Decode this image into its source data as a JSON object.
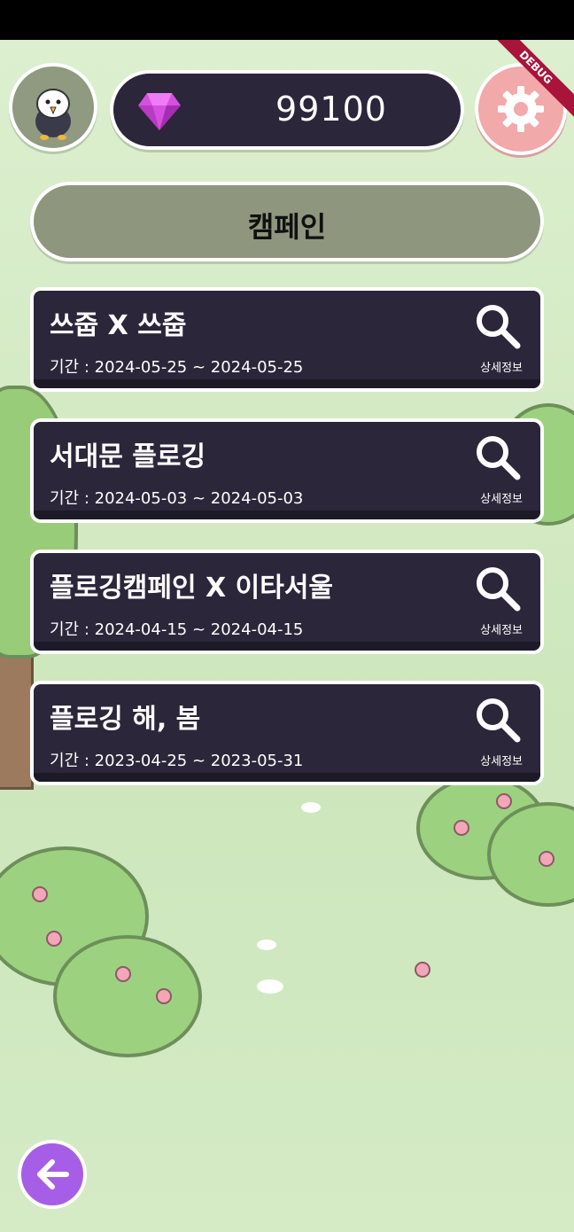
{
  "header": {
    "gem_count": "99100",
    "debug_label": "DEBUG",
    "colors": {
      "gem_bar": "#2b2639",
      "settings": "#f2a9a9",
      "accent": "#a65ee6"
    }
  },
  "campaign": {
    "title": "캠페인",
    "items": [
      {
        "name": "쓰줍 X 쓰줍",
        "period": "기간 : 2024-05-25 ~ 2024-05-25",
        "detail_label": "상세정보"
      },
      {
        "name": "서대문 플로깅",
        "period": "기간 : 2024-05-03 ~ 2024-05-03",
        "detail_label": "상세정보"
      },
      {
        "name": "플로깅캠페인 X 이타서울",
        "period": "기간 : 2024-04-15 ~ 2024-04-15",
        "detail_label": "상세정보"
      },
      {
        "name": "플로깅 해, 봄",
        "period": "기간 : 2023-04-25 ~ 2023-05-31",
        "detail_label": "상세정보"
      }
    ]
  },
  "icons": {
    "avatar": "eagle-mascot-icon",
    "gem": "gem-icon",
    "settings": "gear-icon",
    "search": "search-icon",
    "back": "arrow-left-icon"
  }
}
